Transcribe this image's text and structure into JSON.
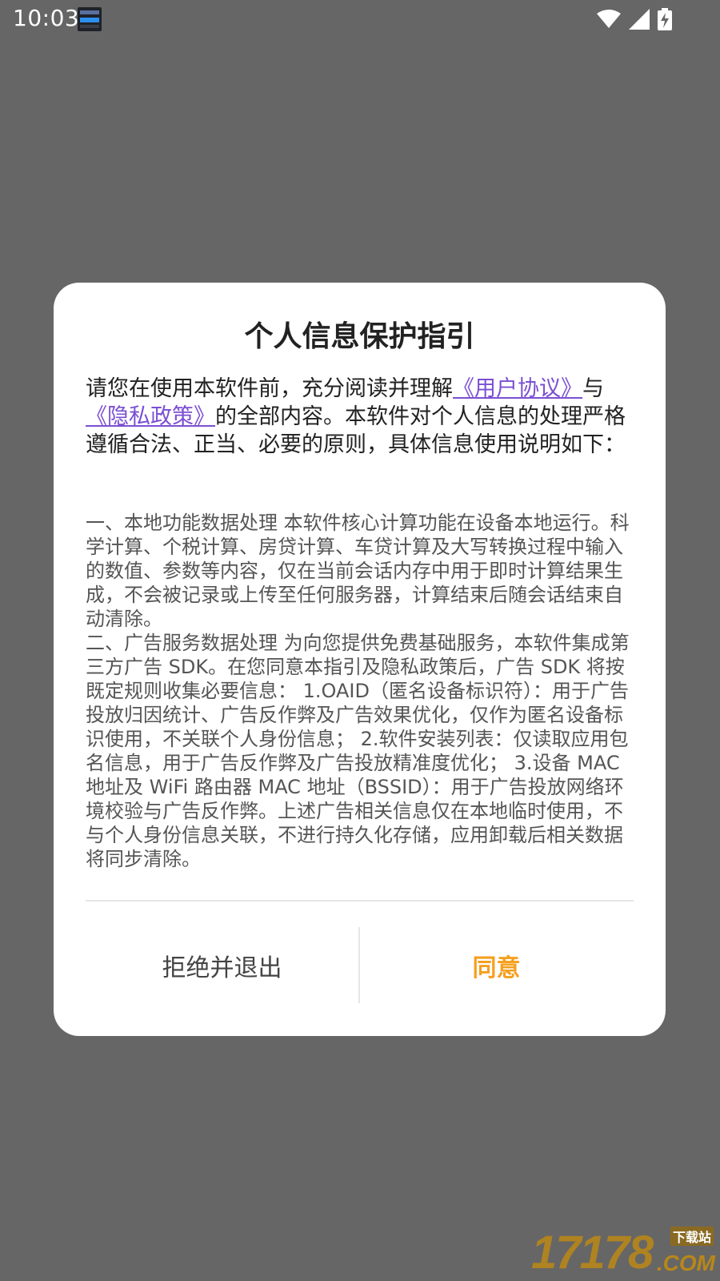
{
  "status_bar": {
    "time": "10:03"
  },
  "dialog": {
    "title": "个人信息保护指引",
    "intro_before": "请您在使用本软件前，充分阅读并理解",
    "user_agreement_link": "《用户协议》",
    "intro_and": "与",
    "privacy_policy_link": "《隐私政策》",
    "intro_after": "的全部内容。本软件对个人信息的处理严格遵循合法、正当、必要的原则，具体信息使用说明如下：",
    "section1": "一、本地功能数据处理 本软件核心计算功能在设备本地运行。科学计算、个税计算、房贷计算、车贷计算及大写转换过程中输入的数值、参数等内容，仅在当前会话内存中用于即时计算结果生成，不会被记录或上传至任何服务器，计算结束后随会话结束自动清除。",
    "section2": "二、广告服务数据处理 为向您提供免费基础服务，本软件集成第三方广告 SDK。在您同意本指引及隐私政策后，广告 SDK 将按既定规则收集必要信息： 1.OAID（匿名设备标识符）：用于广告投放归因统计、广告反作弊及广告效果优化，仅作为匿名设备标识使用，不关联个人身份信息； 2.软件安装列表：仅读取应用包名信息，用于广告反作弊及广告投放精准度优化； 3.设备 MAC 地址及 WiFi 路由器 MAC 地址（BSSID）：用于广告投放网络环境校验与广告反作弊。上述广告相关信息仅在本地临时使用，不与个人身份信息关联，不进行持久化存储，应用卸载后相关数据将同步清除。",
    "reject_label": "拒绝并退出",
    "agree_label": "同意"
  },
  "watermark": {
    "number": "17178",
    "download_label": "下载站",
    "domain": ".COM"
  },
  "colors": {
    "backdrop": "#666666",
    "link": "#7b4fd3",
    "agree": "#f5a01f"
  }
}
